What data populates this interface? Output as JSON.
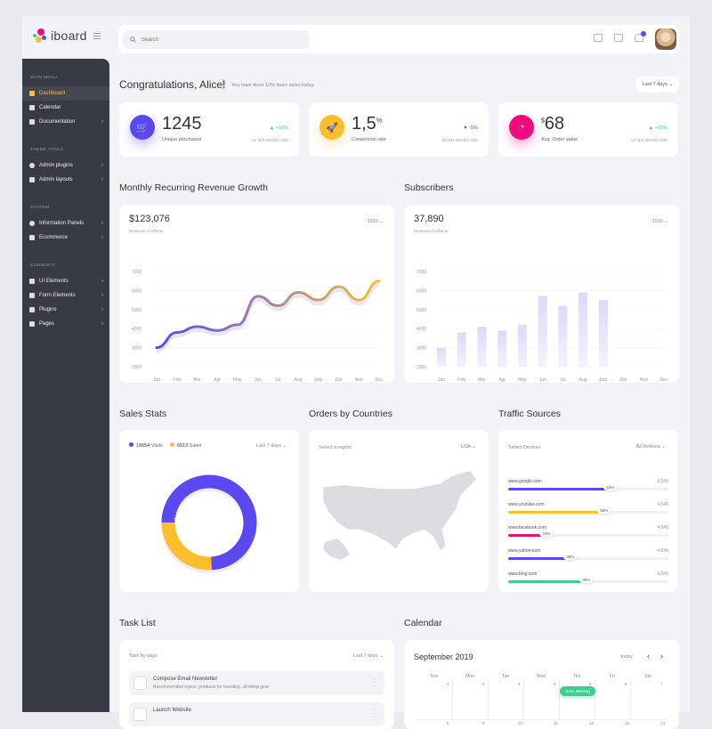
{
  "app": {
    "name": "iboard"
  },
  "search": {
    "placeholder": "Search"
  },
  "topbar": {
    "icons": [
      "calendar-grid-icon",
      "mail-icon",
      "bell-icon"
    ],
    "notifications": 1
  },
  "sidebar": {
    "sections": [
      {
        "title": "Main Menu",
        "items": [
          {
            "label": "Dashboard",
            "icon": "grid-icon",
            "active": true
          },
          {
            "label": "Calendar",
            "icon": "calendar-icon"
          },
          {
            "label": "Documentation",
            "icon": "document-icon",
            "chevron": true
          }
        ]
      },
      {
        "title": "Theme Tools",
        "items": [
          {
            "label": "Admin plugins",
            "icon": "gear-icon",
            "chevron": true
          },
          {
            "label": "Admin layouts",
            "icon": "layout-icon",
            "chevron": true
          }
        ]
      },
      {
        "title": "System",
        "items": [
          {
            "label": "Information Panels",
            "icon": "info-icon",
            "chevron": true
          },
          {
            "label": "Ecommerce",
            "icon": "cart-icon",
            "chevron": true
          }
        ]
      },
      {
        "title": "Elements",
        "items": [
          {
            "label": "UI Elements",
            "icon": "list-icon",
            "chevron": true
          },
          {
            "label": "Form Elements",
            "icon": "form-icon",
            "chevron": true
          },
          {
            "label": "Plugins",
            "icon": "puzzle-icon",
            "chevron": true
          },
          {
            "label": "Pages",
            "icon": "page-icon",
            "chevron": true
          }
        ]
      }
    ]
  },
  "header": {
    "greeting": "Congratulations, Alice!",
    "subtitle": "You have done 10% more sales today.",
    "period": "Last 7 days"
  },
  "stats": [
    {
      "value": "1245",
      "prefix": "",
      "suffix": "",
      "label": "Unique purchases",
      "change": "▲ +10%",
      "change_color": "#3ccf8e",
      "vs": "vs last weekly rate",
      "color": "#5a48f0",
      "icon": "cart-icon",
      "glyph": "🛒"
    },
    {
      "value": "1,5",
      "prefix": "",
      "suffix": "%",
      "label": "Conversion rate",
      "change": "▼ -5%",
      "change_color": "#5a48f0",
      "vs": "vs last weekly rate",
      "color": "#fdbe2c",
      "icon": "rocket-icon",
      "glyph": "🚀"
    },
    {
      "value": "68",
      "prefix": "$",
      "suffix": "",
      "label": "Avg. Order value",
      "change": "▲ +10%",
      "change_color": "#3ccf8e",
      "vs": "vs last weekly rate",
      "color": "#ef0a7e",
      "icon": "pie-icon",
      "glyph": "◔"
    }
  ],
  "revenue": {
    "title": "Monthly Recurring Revenue Growth",
    "value": "$123,076",
    "sub": "Revenue of all time",
    "year": "2019 ⌄"
  },
  "subscribers": {
    "title": "Subscribers",
    "value": "37,890",
    "sub": "Revenue of all time",
    "year": "2019 ⌄"
  },
  "sales": {
    "title": "Sales Stats",
    "visits": "19654",
    "visits_label": "Visits",
    "sales": "6913",
    "sales_label": "Sales",
    "period": "Last 7 days ⌄"
  },
  "orders": {
    "title": "Orders by Countries",
    "placeholder": "Select a region",
    "region": "USA ⌄"
  },
  "traffic": {
    "title": "Traffic Sources",
    "label": "Select Devices",
    "device": "All Devices ⌄",
    "rows": [
      {
        "site": "www.google.com",
        "count": "4,545",
        "pct": 63,
        "color": "#5a48f0"
      },
      {
        "site": "www.youtube.com",
        "count": "4,545",
        "pct": 59,
        "color": "#fdbe2c"
      },
      {
        "site": "www.facebook.com",
        "count": "4,545",
        "pct": 23,
        "color": "#e0137a"
      },
      {
        "site": "www.yahoo.com",
        "count": "4,545",
        "pct": 38,
        "color": "#5a48f0"
      },
      {
        "site": "www.bing.com",
        "count": "4,545",
        "pct": 48,
        "color": "#3ccf8e"
      }
    ]
  },
  "tasks": {
    "title": "Task List",
    "label": "Task by days",
    "period": "Last 7 days ⌄",
    "items": [
      {
        "title": "Compose Email Newsletter",
        "desc": "Recommended topics: products for traveling, climbing gear"
      },
      {
        "title": "Launch Website",
        "desc": ""
      }
    ]
  },
  "calendar": {
    "title": "Calendar",
    "month": "September 2019",
    "today": "today",
    "days": [
      "Sun",
      "Mon",
      "Tue",
      "Wed",
      "Thu",
      "Fri",
      "Sat"
    ],
    "week1": [
      "1",
      "2",
      "3",
      "4",
      "5",
      "6",
      "7"
    ],
    "week2": [
      "8",
      "9",
      "10",
      "11",
      "12",
      "13",
      "14"
    ],
    "event": "Sony Meeting"
  },
  "chart_data": [
    {
      "type": "line",
      "title": "Monthly Recurring Revenue Growth",
      "categories": [
        "Jan",
        "Feb",
        "Mar",
        "Apr",
        "May",
        "Jun",
        "Jul",
        "Aug",
        "Sep",
        "Oct",
        "Nov",
        "Dec"
      ],
      "values": [
        3000,
        3800,
        4100,
        3900,
        4200,
        5700,
        5200,
        5900,
        5500,
        6200,
        5500,
        6500
      ],
      "ylim": [
        2000,
        7000
      ],
      "yticks": [
        2000,
        3000,
        4000,
        5000,
        6000,
        7000
      ],
      "grid": true
    },
    {
      "type": "bar",
      "title": "Subscribers",
      "categories": [
        "Jan",
        "Feb",
        "Mar",
        "Apr",
        "May",
        "Jun",
        "Jul",
        "Aug",
        "Sep",
        "Oct",
        "Nov",
        "Dec"
      ],
      "values": [
        3000,
        3800,
        4100,
        3900,
        4200,
        5700,
        5200,
        5900,
        5500,
        null,
        null,
        null
      ],
      "ylim": [
        2000,
        7000
      ],
      "yticks": [
        2000,
        3000,
        4000,
        5000,
        6000,
        7000
      ],
      "grid": true
    },
    {
      "type": "pie",
      "title": "Sales Stats",
      "series": [
        {
          "name": "Visits",
          "value": 19654,
          "color": "#5a48f0"
        },
        {
          "name": "Sales",
          "value": 6913,
          "color": "#fdbe2c"
        }
      ],
      "donut": true
    }
  ]
}
